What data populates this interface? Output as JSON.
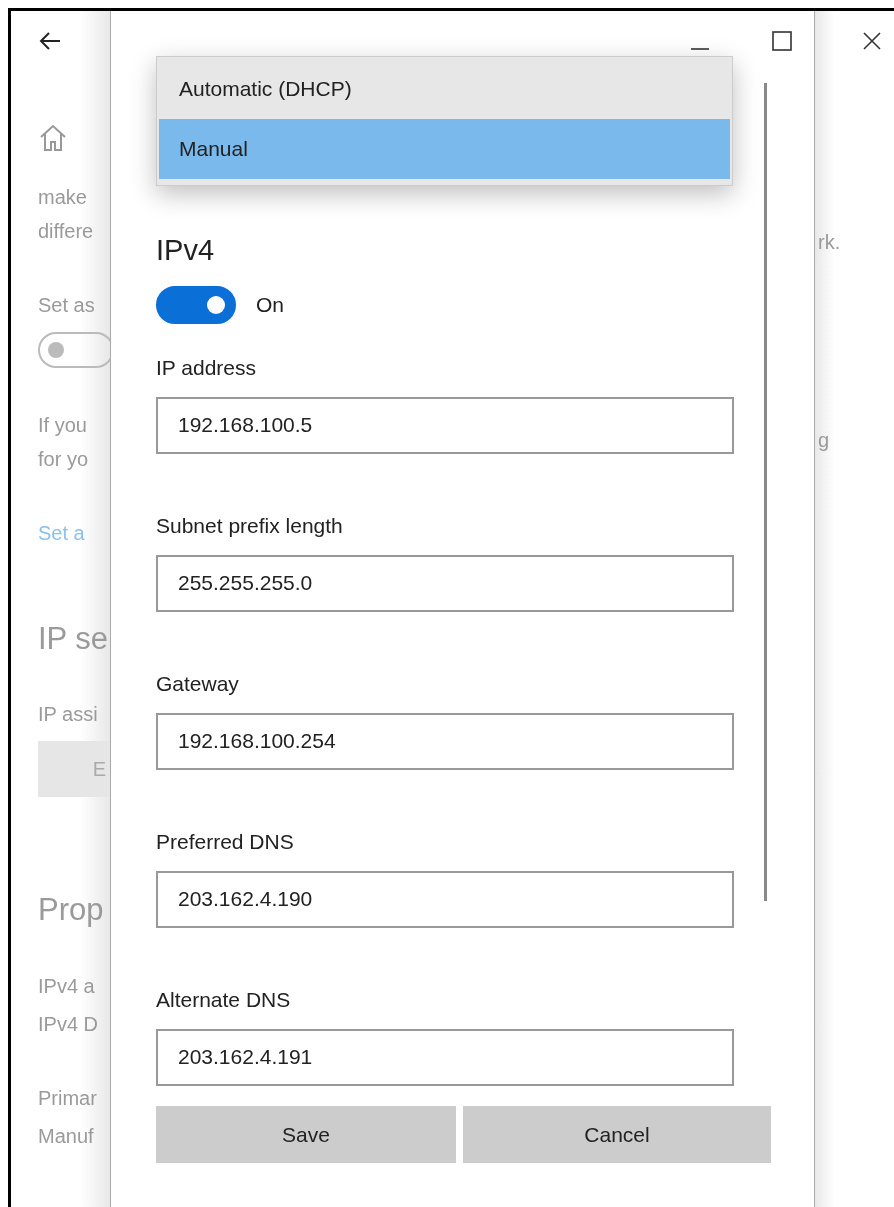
{
  "background": {
    "left_items": [
      {
        "kind": "text",
        "text": "make"
      },
      {
        "kind": "text",
        "text": "differe"
      },
      {
        "kind": "label",
        "text": "Set as"
      },
      {
        "kind": "toggle",
        "on": false
      },
      {
        "kind": "text",
        "text": "If you"
      },
      {
        "kind": "text",
        "text": "for yo"
      },
      {
        "kind": "link",
        "text": "Set a"
      },
      {
        "kind": "heading",
        "text": "IP se"
      },
      {
        "kind": "label",
        "text": "IP assi"
      },
      {
        "kind": "button",
        "text": "E"
      },
      {
        "kind": "heading",
        "text": "Prop"
      },
      {
        "kind": "label",
        "text": "IPv4 a"
      },
      {
        "kind": "label",
        "text": "IPv4 D"
      },
      {
        "kind": "label",
        "text": "Primar"
      },
      {
        "kind": "label",
        "text": "Manuf"
      }
    ],
    "right_texts": [
      "rk.",
      "g"
    ]
  },
  "dialog": {
    "dropdown": {
      "options": [
        {
          "label": "Automatic (DHCP)",
          "selected": false
        },
        {
          "label": "Manual",
          "selected": true
        }
      ]
    },
    "section_title": "IPv4",
    "toggle": {
      "on": true,
      "label": "On"
    },
    "fields": [
      {
        "label": "IP address",
        "value": "192.168.100.5"
      },
      {
        "label": "Subnet prefix length",
        "value": "255.255.255.0"
      },
      {
        "label": "Gateway",
        "value": "192.168.100.254"
      },
      {
        "label": "Preferred DNS",
        "value": "203.162.4.190"
      },
      {
        "label": "Alternate DNS",
        "value": "203.162.4.191"
      }
    ],
    "buttons": [
      "Save",
      "Cancel"
    ]
  }
}
